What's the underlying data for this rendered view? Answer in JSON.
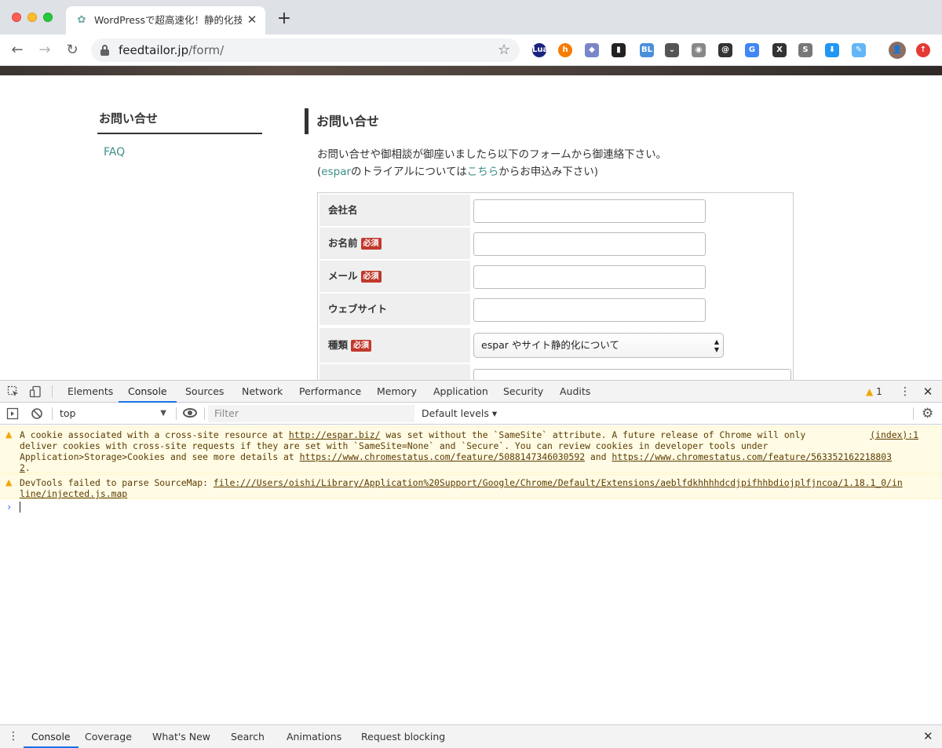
{
  "browser": {
    "tab_title": "WordPressで超高速化！静的化技術",
    "url_host": "feedtailor.jp",
    "url_path": "/form/",
    "new_tab_label": "+",
    "tab_close": "✕",
    "extensions": [
      {
        "name": "lua-extension-icon",
        "label": "Lua",
        "color": "#1a237e"
      },
      {
        "name": "hatena-extension-icon",
        "label": "h",
        "color": "#f57c00"
      },
      {
        "name": "puzzle-extension-icon",
        "label": "◆",
        "color": "#7986cb"
      },
      {
        "name": "bookmark-extension-icon",
        "label": "▮",
        "color": "#222222"
      },
      {
        "name": "bl-extension-icon",
        "label": "BL",
        "color": "#4a90d9"
      },
      {
        "name": "pocket-extension-icon",
        "label": "⌄",
        "color": "#555555"
      },
      {
        "name": "camera-extension-icon",
        "label": "◉",
        "color": "#888888"
      },
      {
        "name": "lock-extension-icon",
        "label": "@",
        "color": "#333333"
      },
      {
        "name": "translate-extension-icon",
        "label": "G",
        "color": "#4285f4"
      },
      {
        "name": "x-extension-icon",
        "label": "X",
        "color": "#333333"
      },
      {
        "name": "s-extension-icon",
        "label": "S",
        "color": "#777777"
      },
      {
        "name": "download-extension-icon",
        "label": "⬇",
        "color": "#2196f3"
      },
      {
        "name": "feather-extension-icon",
        "label": "✎",
        "color": "#64b5f6"
      },
      {
        "name": "profile-avatar",
        "label": "👤",
        "color": "#8d6e63"
      },
      {
        "name": "update-extension-icon",
        "label": "↑",
        "color": "#e53935"
      }
    ]
  },
  "page": {
    "sidebar_title": "お問い合せ",
    "sidebar_faq": "FAQ",
    "main_title": "お問い合せ",
    "intro_line1": "お問い合せや御相談が御座いましたら以下のフォームから御連絡下さい。",
    "intro_prefix": "(",
    "intro_link1": "espar",
    "intro_mid": "のトライアルについては",
    "intro_link2": "こちら",
    "intro_suffix": "からお申込み下さい)",
    "required_badge": "必須",
    "form": {
      "company_label": "会社名",
      "name_label": "お名前",
      "email_label": "メール",
      "website_label": "ウェブサイト",
      "type_label": "種類",
      "type_value": "espar やサイト静的化について"
    }
  },
  "devtools": {
    "tabs": [
      "Elements",
      "Console",
      "Sources",
      "Network",
      "Performance",
      "Memory",
      "Application",
      "Security",
      "Audits"
    ],
    "active_tab": "Console",
    "warning_count": "1",
    "context": "top",
    "filter_placeholder": "Filter",
    "levels": "Default levels ▾",
    "messages": [
      {
        "line1_pre": "A cookie associated with a cross-site resource at ",
        "line1_link": "http://espar.biz/",
        "line1_post": " was set without the `SameSite` attribute. A future release of Chrome will only",
        "line2": "deliver cookies with cross-site requests if they are set with `SameSite=None` and `Secure`. You can review cookies in developer tools under",
        "line3_pre": "Application>Storage>Cookies and see more details at ",
        "line3_link1": "https://www.chromestatus.com/feature/5088147346030592",
        "line3_mid": " and ",
        "line3_link2": "https://www.chromestatus.com/feature/563352162218803",
        "line4_link": "2",
        "line4_post": ".",
        "source": "(index):1"
      },
      {
        "line1_pre": "DevTools failed to parse SourceMap: ",
        "line1_link": "file:///Users/oishi/Library/Application%20Support/Google/Chrome/Default/Extensions/aeblfdkhhhhdcdjpifhhbdiojplfjncoa/1.18.1_0/in",
        "line2_link": "line/injected.js.map"
      }
    ],
    "prompt_symbol": "›",
    "drawer_tabs": [
      "Console",
      "Coverage",
      "What's New",
      "Search",
      "Animations",
      "Request blocking"
    ]
  }
}
